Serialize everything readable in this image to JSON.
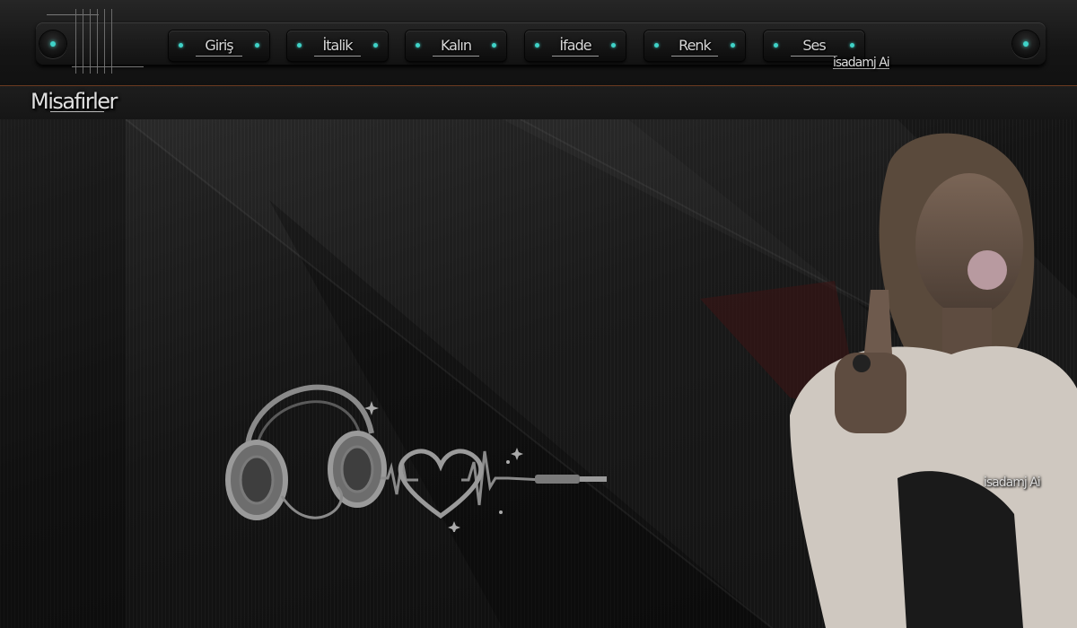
{
  "nav": {
    "items": [
      {
        "label": "Giriş"
      },
      {
        "label": "İtalik"
      },
      {
        "label": "Kalın"
      },
      {
        "label": "İfade"
      },
      {
        "label": "Renk"
      },
      {
        "label": "Ses"
      }
    ]
  },
  "credit": {
    "text": "isadamj Ai"
  },
  "section": {
    "title": "Misafirler"
  },
  "watermark": {
    "text": "isadamj Ai"
  },
  "colors": {
    "accent": "#3fd3c8",
    "border": "#6b3a20"
  },
  "icons": [
    "headphones-icon",
    "heart-icon",
    "heartbeat-line-icon",
    "audio-jack-icon",
    "sparkle-icon"
  ]
}
